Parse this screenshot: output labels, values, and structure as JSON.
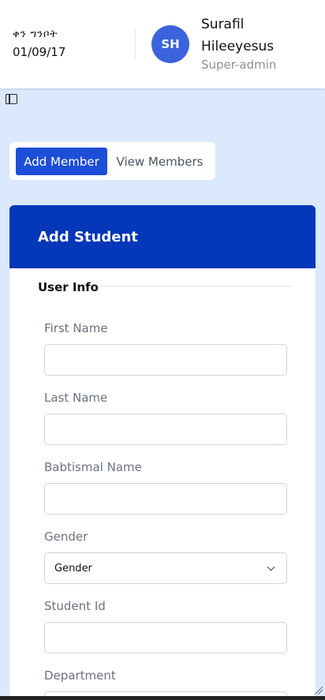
{
  "header": {
    "date_label": "ቀን ግንቦት",
    "date_value": "01/09/17",
    "avatar_initials": "SH",
    "user_name": "Surafil Hileeyesus",
    "user_role": "Super-admin"
  },
  "tabs": [
    {
      "label": "Add Member",
      "active": true
    },
    {
      "label": "View Members",
      "active": false
    }
  ],
  "form": {
    "title": "Add Student",
    "section": "User Info",
    "fields": {
      "first_name": {
        "label": "First Name",
        "value": ""
      },
      "last_name": {
        "label": "Last Name",
        "value": ""
      },
      "babtismal_name": {
        "label": "Babtismal Name",
        "value": ""
      },
      "gender": {
        "label": "Gender",
        "selected": "Gender"
      },
      "student_id": {
        "label": "Student Id",
        "value": ""
      },
      "department": {
        "label": "Department",
        "value": ""
      }
    }
  },
  "colors": {
    "primary": "#1d4ed8",
    "header_blue": "#0537b9",
    "avatar": "#3b63dc",
    "background": "#dbe8fd"
  },
  "icons": {
    "sidebar_toggle": "sidebar-toggle-icon",
    "select_chevron": "chevron-down-icon",
    "resize": "resize-handle-icon"
  }
}
